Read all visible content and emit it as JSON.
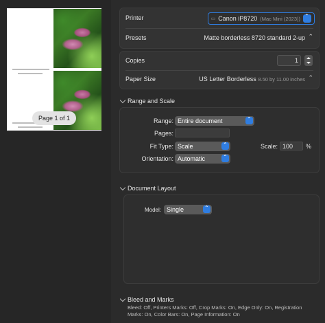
{
  "preview": {
    "page_indicator": "Page 1 of 1"
  },
  "printer": {
    "label": "Printer",
    "name": "Canon iP8720",
    "detail": "(Mac Mini (2023))"
  },
  "presets": {
    "label": "Presets",
    "value": "Matte borderless 8720 standard 2-up"
  },
  "copies": {
    "label": "Copies",
    "value": "1"
  },
  "paper_size": {
    "label": "Paper Size",
    "value": "US Letter Borderless",
    "detail": "8.50 by 11.00 inches"
  },
  "range_and_scale": {
    "title": "Range and Scale",
    "range_label": "Range:",
    "range_value": "Entire document",
    "pages_label": "Pages:",
    "pages_value": "",
    "fit_type_label": "Fit Type:",
    "fit_type_value": "Scale",
    "scale_label": "Scale:",
    "scale_value": "100",
    "scale_unit": "%",
    "orientation_label": "Orientation:",
    "orientation_value": "Automatic"
  },
  "document_layout": {
    "title": "Document Layout",
    "model_label": "Model:",
    "model_value": "Single"
  },
  "bleed_and_marks": {
    "title": "Bleed and Marks",
    "summary": "Bleed: Off, Printers Marks: Off, Crop Marks: On, Edge Only: On, Registration Marks: On, Color Bars: On, Page Information: On"
  }
}
